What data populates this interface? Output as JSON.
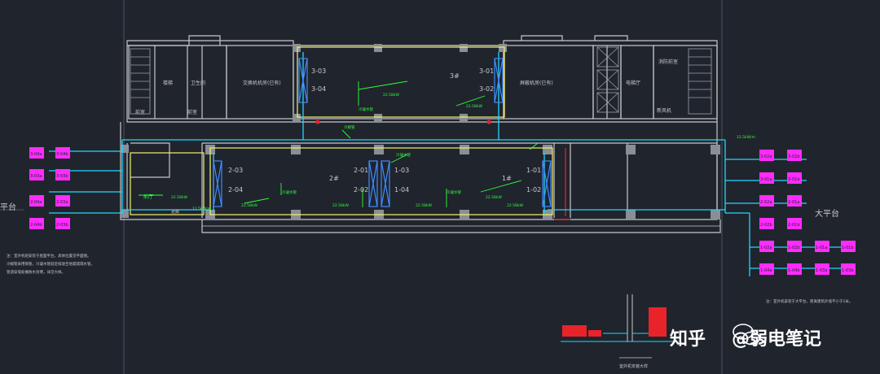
{
  "colors": {
    "background": "#20242d",
    "wall": "#c8c8c8",
    "pipe": "#20d8ff",
    "label_green": "#2dff3a",
    "unit_magenta": "#ff2bff",
    "unit_yellow": "#f5f26a",
    "unit_red": "#e8242a",
    "watermark": "#ffffff"
  },
  "rooms": {
    "room3": "3#",
    "room2": "2#",
    "room1": "1#",
    "left_upper": "交换机机房(已有)",
    "right_upper": "屏蔽机房(已有)",
    "stairs_left": "楼梯",
    "elevator": "电梯厅",
    "toilet": "卫生间",
    "right_small": "消防前室",
    "right_bottom": "新风机",
    "left_bottom": "前室",
    "left_bottom2": "前室",
    "corridor_left": "前厅",
    "corridor_left2": "走廊",
    "balcony": "大平台",
    "balcony_left": "平台"
  },
  "units": {
    "u303": "3-03",
    "u304": "3-04",
    "u301": "3-01",
    "u302": "3-02",
    "u203": "2-03",
    "u204": "2-04",
    "u201": "2-01",
    "u202": "2-02",
    "u103": "1-03",
    "u104": "1-04",
    "u101": "1-01",
    "u102": "1-02"
  },
  "pipe_notes": {
    "n1": "22.58kW",
    "n2": "22.58kW",
    "n3": "22.58kW",
    "n4": "22.58kW",
    "n5": "22.58kW",
    "n6": "22.58kW",
    "n7": "22.58kW",
    "n8": "22.58kW",
    "n9": "冷凝水管",
    "n10": "冷凝水管",
    "n11": "冷凝水管",
    "n12": "冷凝水管",
    "n13": "12.5kW/m",
    "n14": "12.5kW/m",
    "n15": "冷媒管"
  },
  "outdoor_left": [
    "3-04a",
    "3-04b",
    "3-03a",
    "3-03b",
    "2-04a",
    "2-03a",
    "2-04b",
    "2-03b"
  ],
  "outdoor_right": [
    "3-02a",
    "3-02b",
    "3-01a",
    "3-01b",
    "2-02a",
    "2-01a",
    "2-02b",
    "2-01b",
    "1-02a",
    "1-02b",
    "1-01a",
    "1-01b",
    "1-04a",
    "1-04b",
    "1-03a",
    "1-03b"
  ],
  "notes": {
    "left_1": "注：室外机组安装于屋面平台，具体位置见平面图。",
    "left_2": "冷媒管采用铜管，冷凝水管就近排放至地漏或雨水管。",
    "left_3": "管道穿墙处做防水封堵，详见大样。",
    "right_1": "注：室外机安装于大平台，距离建筑外墙不小于1米。"
  },
  "detail_caption": "室外机安装大样",
  "watermark": {
    "brand": "知乎",
    "account": "@弱电笔记"
  }
}
